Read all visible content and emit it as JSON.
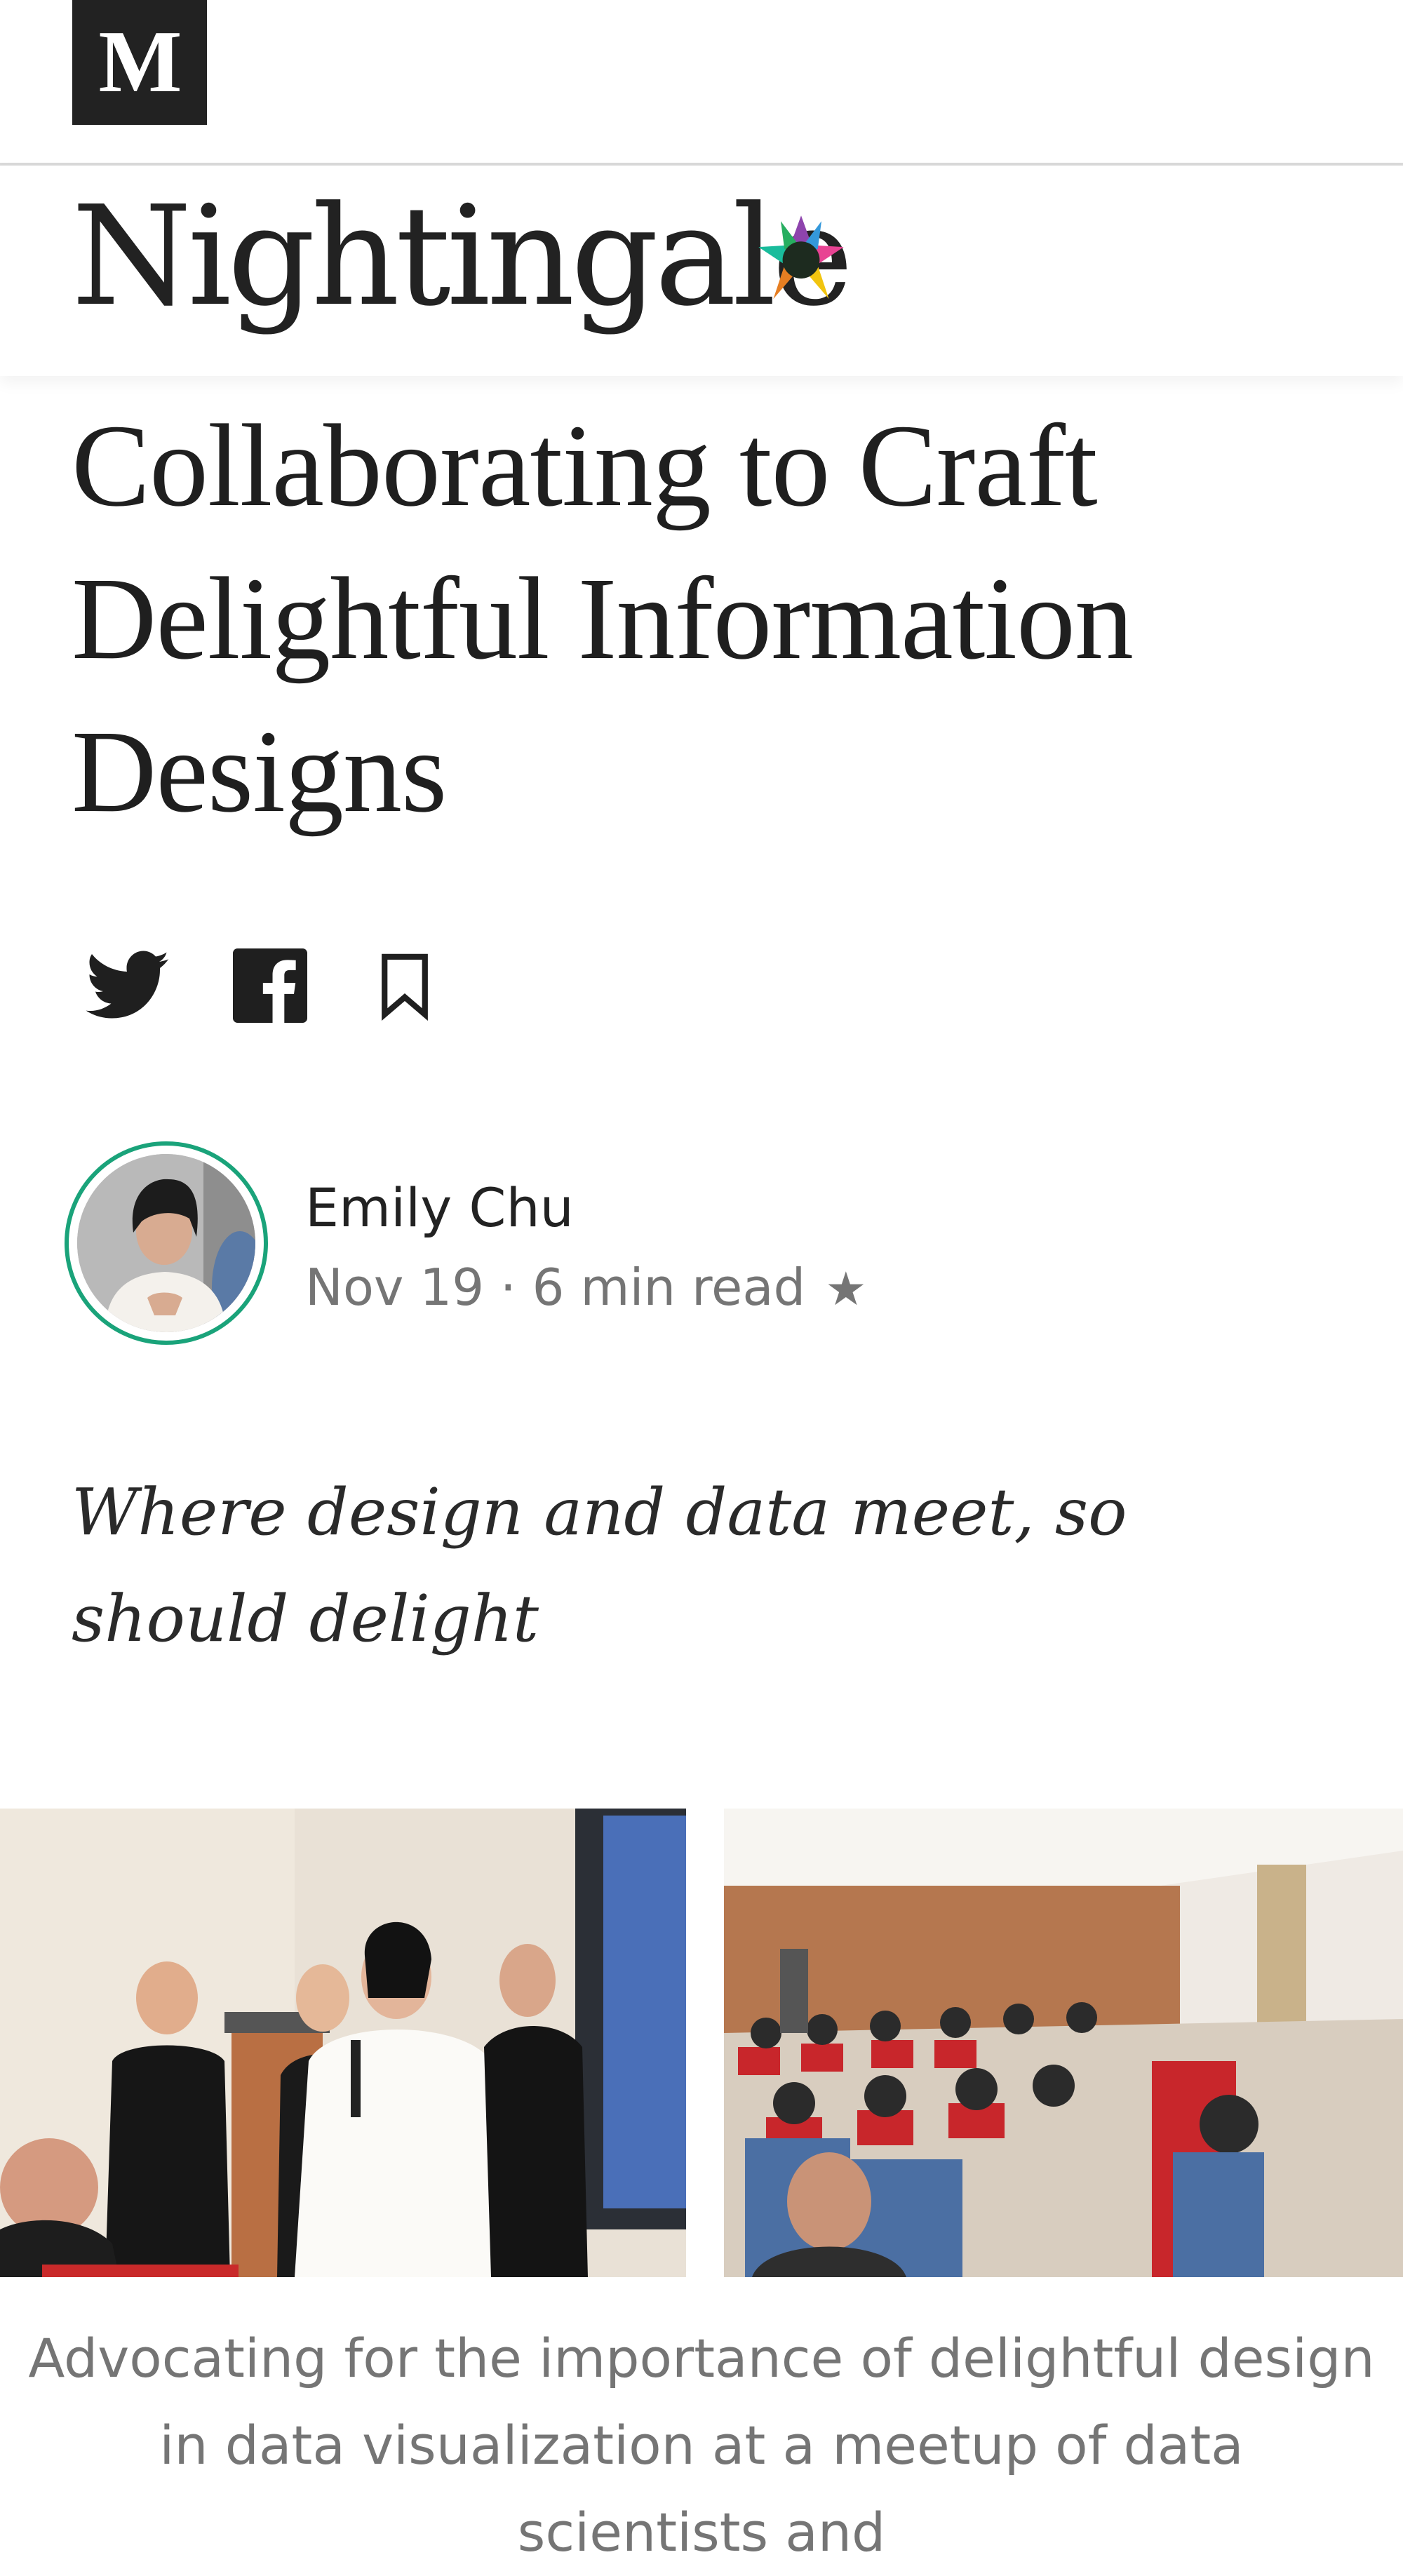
{
  "header": {
    "site_logo_text": "M"
  },
  "publication": {
    "name": "Nightingale",
    "logo_icon": "star-logo-icon"
  },
  "article": {
    "title": "Collaborating to Craft Delightful Information Designs",
    "subtitle": "Where design and data meet, so should delight",
    "caption": "Advocating for the importance of delightful design in data visualization at a meetup of data scientists and"
  },
  "share": {
    "icons": [
      "twitter-icon",
      "facebook-icon",
      "bookmark-icon"
    ]
  },
  "author": {
    "name": "Emily Chu",
    "meta": "Nov 19 · 6 min read",
    "star": "★",
    "ring_color": "#1aa37a"
  },
  "colors": {
    "text": "#1f1f1f",
    "muted": "#757575",
    "logo_bg": "#222222"
  }
}
